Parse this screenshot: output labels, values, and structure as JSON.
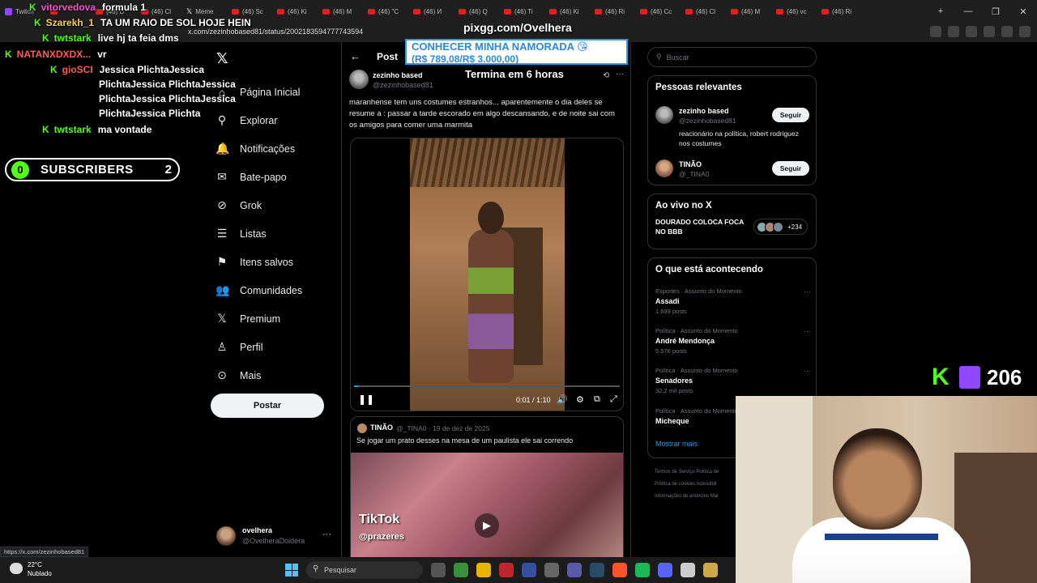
{
  "browser": {
    "tabs": [
      {
        "label": "Twitch",
        "icon": "twitch"
      },
      {
        "label": "",
        "icon": "youtube"
      },
      {
        "label": "(46) D",
        "icon": "youtube"
      },
      {
        "label": "(46) Cl",
        "icon": "youtube"
      },
      {
        "label": "Meme",
        "icon": "x"
      },
      {
        "label": "(46) Sc",
        "icon": "youtube"
      },
      {
        "label": "(46) Ki",
        "icon": "youtube"
      },
      {
        "label": "(46) M",
        "icon": "youtube"
      },
      {
        "label": "(46) \"C",
        "icon": "youtube"
      },
      {
        "label": "(46) И",
        "icon": "youtube"
      },
      {
        "label": "(46) Q",
        "icon": "youtube"
      },
      {
        "label": "(46) Ti",
        "icon": "youtube"
      },
      {
        "label": "(46) Ki",
        "icon": "youtube"
      },
      {
        "label": "(46) Ri",
        "icon": "youtube"
      },
      {
        "label": "(46) Cc",
        "icon": "youtube"
      },
      {
        "label": "(46) Cl",
        "icon": "youtube"
      },
      {
        "label": "(46) M",
        "icon": "youtube"
      },
      {
        "label": "(46) vc",
        "icon": "youtube"
      },
      {
        "label": "(46) Ri",
        "icon": "youtube"
      }
    ],
    "url": "x.com/zezinhobased81/status/2002183594777743594",
    "status_url": "https://x.com/zezinhobased81"
  },
  "chat": [
    {
      "user": "vitorvedova",
      "color": "#ff4fd8",
      "msg": "formula 1"
    },
    {
      "user": "Szarekh_1",
      "color": "#ffd24a",
      "msg": "TA UM RAIO DE SOL HOJE HEIN"
    },
    {
      "user": "twtstark",
      "color": "#53fc18",
      "msg": "live hj ta feia dms"
    },
    {
      "user": "NATANXDXDX...",
      "color": "#ff5a5a",
      "msg": "vr"
    },
    {
      "user": "gioSCI",
      "color": "#ff5a5a",
      "msg": "Jessica PlichtaJessica"
    },
    {
      "user": "",
      "color": "#fff",
      "msg": "PlichtaJessica PlichtaJessica"
    },
    {
      "user": "",
      "color": "#fff",
      "msg": "PlichtaJessica PlichtaJessica"
    },
    {
      "user": "",
      "color": "#fff",
      "msg": "PlichtaJessica Plichta"
    },
    {
      "user": "twtstark",
      "color": "#53fc18",
      "msg": "ma vontade"
    }
  ],
  "subscribers": {
    "left": "0",
    "label": "SUBSCRIBERS",
    "right": "2"
  },
  "overlay": {
    "pix_site": "pixgg.com/Ovelhera",
    "pix_line1": "CONHECER MINHA NAMORADA 😘",
    "pix_line2": "(R$ 789,08/R$ 3.000,00)",
    "timer": "Termina em 6 horas",
    "viewers": "206"
  },
  "nav": {
    "logo": "𝕏",
    "items": [
      {
        "label": "Página Inicial",
        "icon": "home-icon",
        "glyph": "⌂"
      },
      {
        "label": "Explorar",
        "icon": "search-icon",
        "glyph": "⚲"
      },
      {
        "label": "Notificações",
        "icon": "bell-icon",
        "glyph": "🔔"
      },
      {
        "label": "Bate-papo",
        "icon": "mail-icon",
        "glyph": "✉"
      },
      {
        "label": "Grok",
        "icon": "grok-icon",
        "glyph": "⊘"
      },
      {
        "label": "Listas",
        "icon": "list-icon",
        "glyph": "☰"
      },
      {
        "label": "Itens salvos",
        "icon": "bookmark-icon",
        "glyph": "⚑"
      },
      {
        "label": "Comunidades",
        "icon": "communities-icon",
        "glyph": "👥"
      },
      {
        "label": "Premium",
        "icon": "x-premium-icon",
        "glyph": "𝕏"
      },
      {
        "label": "Perfil",
        "icon": "person-icon",
        "glyph": "♙"
      },
      {
        "label": "Mais",
        "icon": "more-circle-icon",
        "glyph": "⊙"
      }
    ],
    "post_button": "Postar",
    "account": {
      "name": "ovelhera",
      "handle": "@OvelheraDoidera",
      "more": "···"
    }
  },
  "post": {
    "header": "Post",
    "author_name": "zezinho based",
    "author_handle": "@zezinhobased81",
    "text": "maranhense tem uns costumes estranhos... aparentemente o dia deles se resume a : passar a tarde escorado em algo descansando, e de noite sai com os amigos para comer uma marmita",
    "video": {
      "time": "0:01 / 1:10",
      "progress": 0.015
    }
  },
  "quote": {
    "name": "TINÃO",
    "meta": "@_TINA0 · 19 de dez de 2025",
    "text": "Se jogar um prato desses na mesa de um paulista ele sai correndo",
    "tiktok": "TikTok",
    "tiktok_user": "@prazeres"
  },
  "sidebar": {
    "search_placeholder": "Buscar",
    "relevant_title": "Pessoas relevantes",
    "people": [
      {
        "name": "zezinho based",
        "handle": "@zezinhobased81",
        "bio": "reacionário na política, robert rodriguez nos costumes",
        "follow": "Seguir"
      },
      {
        "name": "TINÃO",
        "handle": "@_TINA0",
        "bio": "",
        "follow": "Seguir"
      }
    ],
    "live_title": "Ao vivo no X",
    "live_item": "DOURADO COLOCA FOCA NO BBB",
    "live_count": "+234",
    "trends_title": "O que está acontecendo",
    "trends": [
      {
        "category": "Esportes · Assunto do Momento",
        "title": "Assadi",
        "posts": "1.699 posts"
      },
      {
        "category": "Política · Assunto do Momento",
        "title": "André Mendonça",
        "posts": "5.576 posts"
      },
      {
        "category": "Política · Assunto do Momento",
        "title": "Senadores",
        "posts": "32,2 mil posts"
      },
      {
        "category": "Política · Assunto do Momento",
        "title": "Micheque",
        "posts": ""
      }
    ],
    "show_more": "Mostrar mais",
    "footer": [
      "Termos de Serviço   Política de",
      "Política de cookies   Acessibili",
      "Informações de anúncios   Mai"
    ]
  },
  "taskbar": {
    "temp": "22°C",
    "weather": "Nublado",
    "search": "Pesquisar"
  }
}
